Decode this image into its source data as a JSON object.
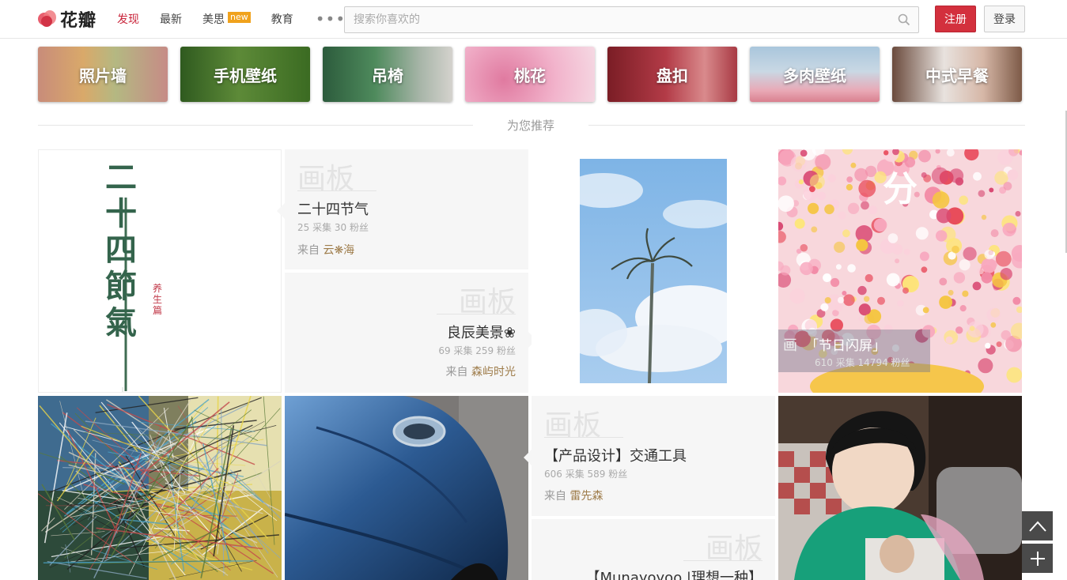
{
  "header": {
    "logo_text": "花瓣",
    "nav": [
      {
        "label": "发现",
        "active": true
      },
      {
        "label": "最新"
      },
      {
        "label": "美思",
        "badge": "new"
      },
      {
        "label": "教育"
      }
    ],
    "more_label": "•••",
    "search_placeholder": "搜索你喜欢的",
    "register_label": "注册",
    "login_label": "登录",
    "brand_color": "#d3303d"
  },
  "categories": [
    {
      "label": "照片墙"
    },
    {
      "label": "手机壁纸"
    },
    {
      "label": "吊椅"
    },
    {
      "label": "桃花"
    },
    {
      "label": "盘扣"
    },
    {
      "label": "多肉壁纸"
    },
    {
      "label": "中式早餐"
    }
  ],
  "section_title": "为您推荐",
  "boards": {
    "b1": {
      "watermark": "画板",
      "title": "二十四节气",
      "stats": "25 采集   30 粉丝",
      "from_label": "来自",
      "user": "云❋海"
    },
    "b2": {
      "watermark": "画板",
      "title": "良辰美景❀",
      "stats": "69 采集   259 粉丝",
      "from_label": "来自",
      "user": "森屿时光"
    },
    "b3": {
      "watermark": "画板",
      "title": "【产品设计】交通工具",
      "stats": "606 采集   589 粉丝",
      "from_label": "来自",
      "user": "雷先森"
    },
    "b4": {
      "watermark": "画板",
      "title": "【Munayoyoo |理想一种】"
    },
    "b5": {
      "watermark": "画",
      "title": "「节日闪屏」",
      "stats": "610 采集   14794 粉丝"
    }
  },
  "pins": {
    "solar_terms": {
      "text_main": "二十四節氣",
      "seal": "养生篇"
    },
    "flash_char": "分"
  },
  "float_buttons": {
    "top_icon": "chevron-up-icon",
    "add_icon": "plus-icon"
  }
}
